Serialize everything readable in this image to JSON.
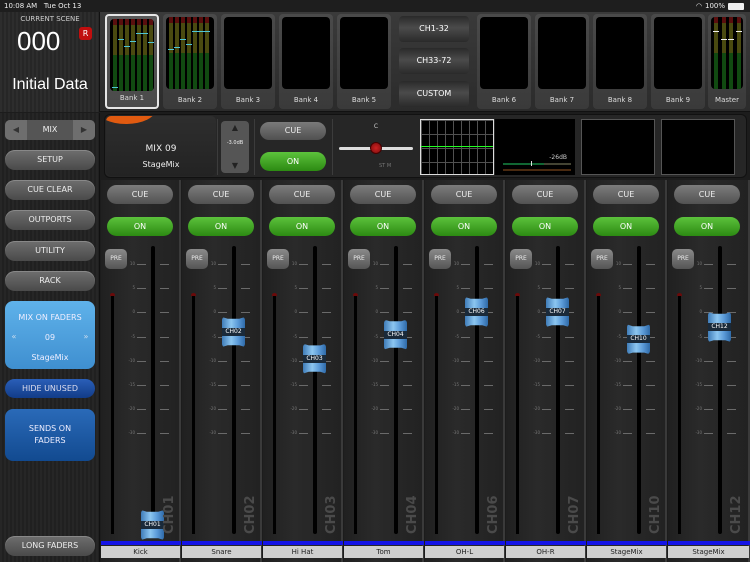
{
  "status_bar": {
    "time": "10:08 AM",
    "date": "Tue Oct 13",
    "battery": "100%",
    "wifi_icon": "wifi-icon",
    "battery_icon": "battery-icon"
  },
  "scene": {
    "label": "CURRENT SCENE",
    "number": "000",
    "badge": "R",
    "name": "Initial Data"
  },
  "banks": [
    {
      "label": "Bank 1",
      "selected": true,
      "meters": [
        0.05,
        0.72,
        0.62,
        0.7,
        0.8,
        0.8,
        0.68,
        0.74
      ]
    },
    {
      "label": "Bank 2",
      "selected": false,
      "meters": [
        0.55,
        0.58,
        0.7,
        0.62,
        0.8,
        0.8,
        0.8
      ]
    },
    {
      "label": "Bank 3",
      "selected": false,
      "meters": []
    },
    {
      "label": "Bank 4",
      "selected": false,
      "meters": []
    },
    {
      "label": "Bank 5",
      "selected": false,
      "meters": []
    },
    {
      "label": "Bank 6",
      "selected": false,
      "meters": []
    },
    {
      "label": "Bank 7",
      "selected": false,
      "meters": []
    },
    {
      "label": "Bank 8",
      "selected": false,
      "meters": []
    },
    {
      "label": "Bank 9",
      "selected": false,
      "meters": []
    },
    {
      "label": "Master",
      "selected": false,
      "meters": [
        0.8,
        0.7,
        0.7,
        0.8
      ]
    }
  ],
  "channel_groups": [
    {
      "label": "CH1-32",
      "active": true
    },
    {
      "label": "CH33-72",
      "active": false
    },
    {
      "label": "CUSTOM",
      "active": false
    }
  ],
  "sidebar": {
    "mix_selector": {
      "label": "MIX",
      "prev_icon": "triangle-left-icon",
      "next_icon": "triangle-right-icon"
    },
    "buttons": [
      "SETUP",
      "CUE CLEAR",
      "OUTPORTS",
      "UTILITY",
      "RACK"
    ],
    "mix_on_faders": {
      "title": "MIX ON FADERS",
      "number": "09",
      "name": "StageMix",
      "prev_icon": "double-chevron-left-icon",
      "next_icon": "double-chevron-right-icon"
    },
    "hide_unused": "HIDE UNUSED",
    "sends_on_faders": [
      "SENDS ON",
      "FADERS"
    ],
    "long_faders": "LONG FADERS"
  },
  "mix_panel": {
    "mix_label": "MIX 09",
    "mix_name": "StageMix",
    "level": "-3.0dB",
    "cue": "CUE",
    "on": "ON",
    "pan_label": "C",
    "pan_mode": "ST  M",
    "pan_value": 0,
    "dynamics_threshold": "-26dB"
  },
  "fader_scale": [
    "10",
    "5",
    "0",
    "-5",
    "-10",
    "-15",
    "-20",
    "-30"
  ],
  "strips": [
    {
      "id": "CH01",
      "name": "Kick",
      "cue": "CUE",
      "on": "ON",
      "pre": "PRE",
      "fader_db": -60
    },
    {
      "id": "CH02",
      "name": "Snare",
      "cue": "CUE",
      "on": "ON",
      "pre": "PRE",
      "fader_db": -4
    },
    {
      "id": "CH03",
      "name": "Hi Hat",
      "cue": "CUE",
      "on": "ON",
      "pre": "PRE",
      "fader_db": -9.5
    },
    {
      "id": "CH04",
      "name": "Tom",
      "cue": "CUE",
      "on": "ON",
      "pre": "PRE",
      "fader_db": -4.5
    },
    {
      "id": "CH06",
      "name": "OH-L",
      "cue": "CUE",
      "on": "ON",
      "pre": "PRE",
      "fader_db": 0
    },
    {
      "id": "CH07",
      "name": "OH-R",
      "cue": "CUE",
      "on": "ON",
      "pre": "PRE",
      "fader_db": 0
    },
    {
      "id": "CH10",
      "name": "StageMix",
      "cue": "CUE",
      "on": "ON",
      "pre": "PRE",
      "fader_db": -5.5
    },
    {
      "id": "CH12",
      "name": "StageMix",
      "cue": "CUE",
      "on": "ON",
      "pre": "PRE",
      "fader_db": -3
    }
  ]
}
